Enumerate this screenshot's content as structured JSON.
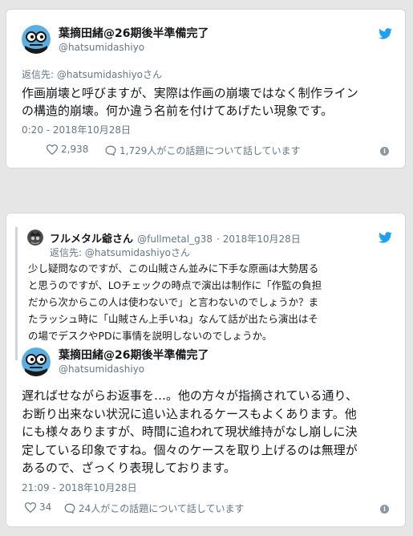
{
  "tweet1": {
    "display_name": "葉摘田緒@26期後半準備完了",
    "handle": "@hatsumidashiyo",
    "reply_prefix": "返信先: ",
    "reply_to": "@hatsumidashiyoさん",
    "text_lines": [
      "作画崩壊と呼びますが、実際は作画の崩壊ではなく制作ライン",
      "の構造的崩壊。何か違う名前を付けてあげたい現象です。"
    ],
    "timestamp": "0:20 - 2018年10月28日",
    "likes": "2,938",
    "talking": "1,729人がこの話題について話しています"
  },
  "tweet2": {
    "quoted": {
      "display_name": "フルメタル爺さん",
      "handle": "@fullmetal_g38",
      "date": "· 2018年10月28日",
      "reply_prefix": "返信先: ",
      "reply_to": "@hatsumidashiyoさん",
      "text_lines": [
        "少し疑問なのですが、この山賊さん並みに下手な原画は大勢居る",
        "と思うのですが、LOチェックの時点で演出は制作に「作監の負担",
        "だから次からこの人は使わないで」と言わないのでしょうか？ま",
        "たラッシュ時に「山賊さん上手いね」なんて話が出たら演出はそ",
        "の場でデスクやPDに事情を説明しないのでしょうか。"
      ]
    },
    "display_name": "葉摘田緒@26期後半準備完了",
    "handle": "@hatsumidashiyo",
    "text_lines": [
      "遅ればせながらお返事を…。他の方々が指摘されている通り、",
      "お断り出来ない状況に追い込まれるケースもよくあります。他",
      "にも様々ありますが、時間に追われて現状維持がなし崩しに決",
      "定している印象ですね。個々のケースを取り上げるのは無理が",
      "あるので、ざっくり表現しております。"
    ],
    "timestamp": "21:09 - 2018年10月28日",
    "likes": "34",
    "talking": "24人がこの話題について話しています"
  },
  "colors": {
    "twitter_blue": "#1da1f2",
    "secondary_text": "#657786",
    "background": "#e6e6e6"
  },
  "icons": [
    "avatar",
    "twitter-bird-icon",
    "heart-icon",
    "comment-icon",
    "info-icon"
  ]
}
